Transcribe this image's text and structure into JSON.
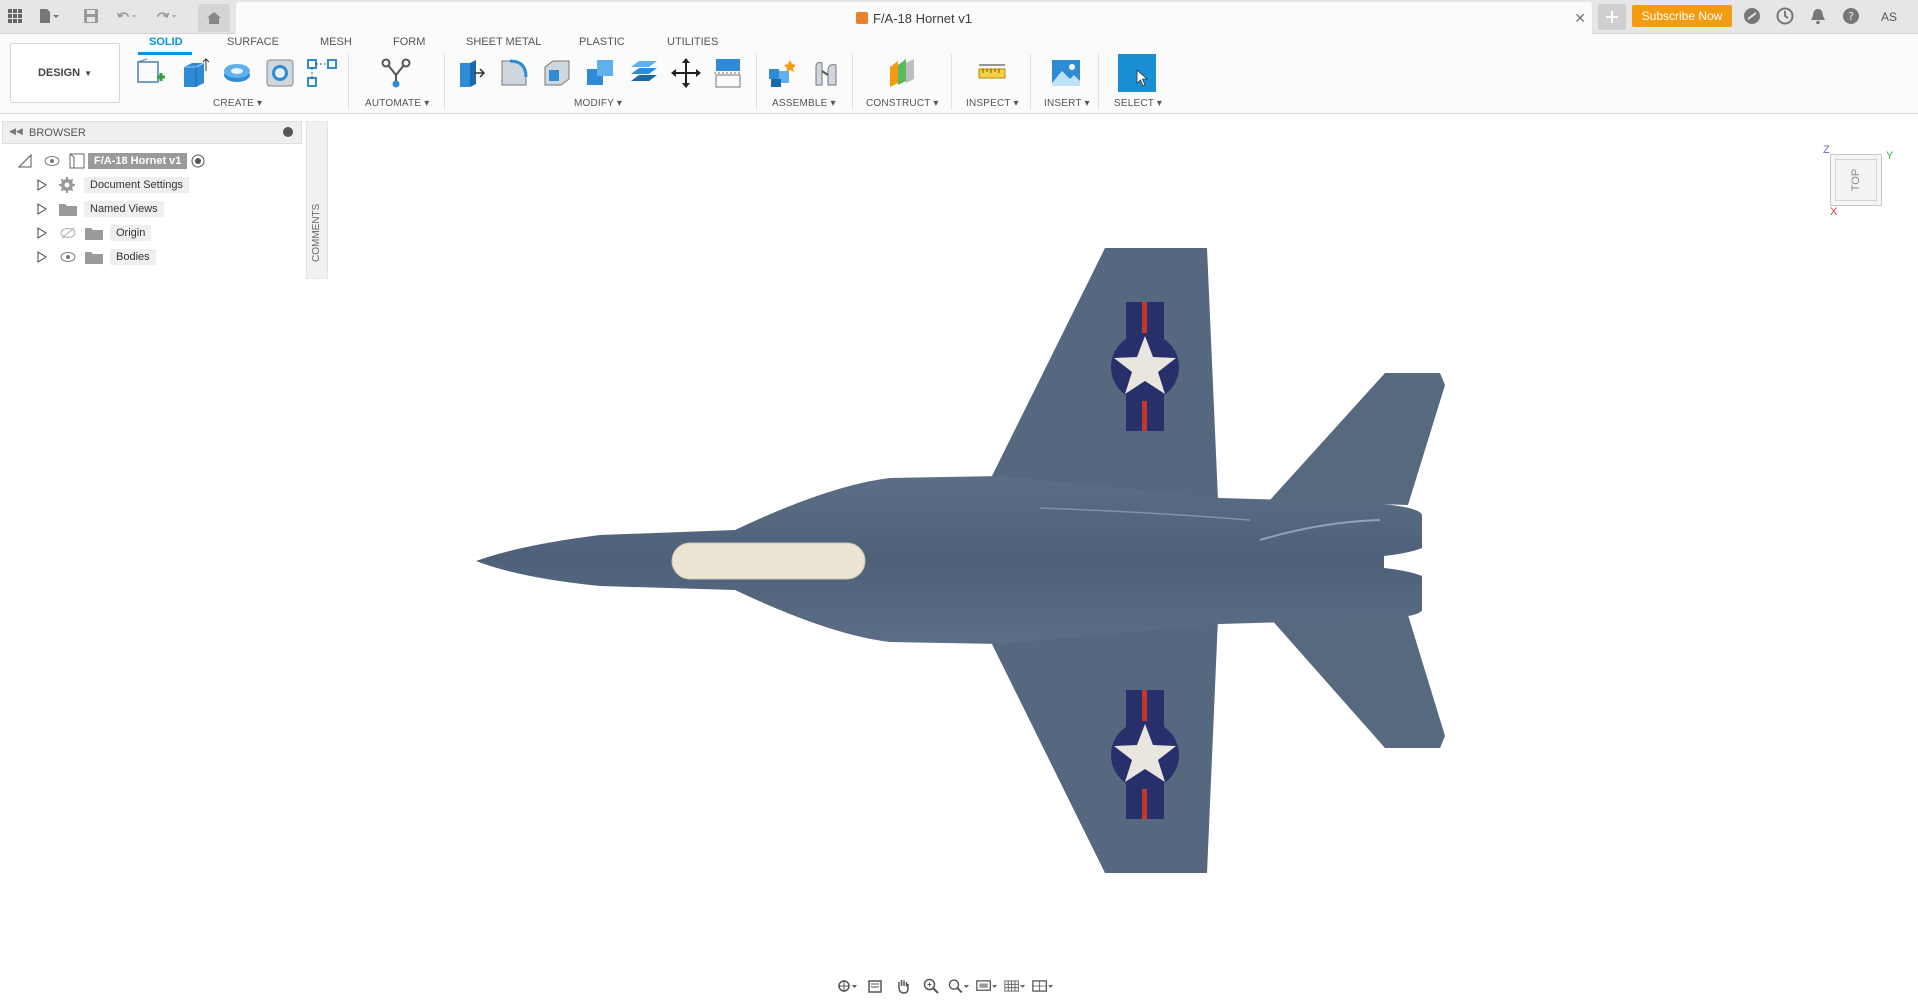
{
  "app": {
    "document_title": "F/A-18 Hornet v1",
    "subscribe_label": "Subscribe Now",
    "user_initials": "AS"
  },
  "colors": {
    "accent": "#0696d7",
    "subscribe": "#f39c12",
    "airframe": "#55687f",
    "canopy": "#ece4d3",
    "roundel_blue": "#27306b",
    "roundel_red": "#c0392b",
    "star": "#e9e6df"
  },
  "toolbar": {
    "workspace": "DESIGN",
    "tabs": [
      {
        "label": "SOLID",
        "active": true
      },
      {
        "label": "SURFACE",
        "active": false
      },
      {
        "label": "MESH",
        "active": false
      },
      {
        "label": "FORM",
        "active": false
      },
      {
        "label": "SHEET METAL",
        "active": false
      },
      {
        "label": "PLASTIC",
        "active": false
      },
      {
        "label": "UTILITIES",
        "active": false
      }
    ],
    "groups": [
      "CREATE",
      "AUTOMATE",
      "MODIFY",
      "ASSEMBLE",
      "CONSTRUCT",
      "INSPECT",
      "INSERT",
      "SELECT"
    ]
  },
  "browser": {
    "title": "BROWSER",
    "root": "F/A-18 Hornet v1",
    "items": [
      {
        "label": "Document Settings",
        "icon": "gear-icon"
      },
      {
        "label": "Named Views",
        "icon": "folder-icon"
      },
      {
        "label": "Origin",
        "icon": "folder-icon"
      },
      {
        "label": "Bodies",
        "icon": "folder-icon"
      }
    ]
  },
  "comments": {
    "label": "COMMENTS"
  },
  "viewcube": {
    "face": "TOP",
    "axes": [
      "Z",
      "Y",
      "X"
    ]
  }
}
